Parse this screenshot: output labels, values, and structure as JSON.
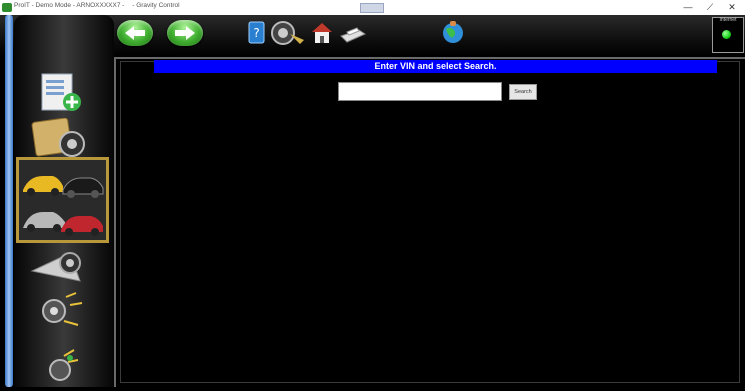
{
  "window": {
    "title": "ProIT - Demo Mode - ARNOXXXXX7 -",
    "title_extra": "- Gravity Control",
    "center_tab": "",
    "controls": {
      "minimize": "—",
      "restore": "⟋",
      "close": "✕"
    }
  },
  "toolbar": {
    "back_icon": "back-arrow-icon",
    "forward_icon": "forward-arrow-icon",
    "tools": [
      "help-book-icon",
      "wheel-icon",
      "home-icon",
      "printer-icon",
      "globe-person-icon"
    ],
    "internet_label": "Internet",
    "internet_status_color": "#19d219"
  },
  "sidebar": {
    "items": [
      {
        "icon": "car-icon"
      },
      {
        "icon": "add-document-icon"
      },
      {
        "icon": "clipboard-wheel-icon"
      },
      {
        "icon": "vehicle-selection-icon",
        "selected": true
      },
      {
        "icon": "wheel-alignment-icon"
      },
      {
        "icon": "wheel-adjust-icon"
      },
      {
        "icon": "wheel-settings-icon"
      }
    ]
  },
  "main": {
    "instruction": "Enter VIN and select Search.",
    "vin_value": "",
    "search_label": "Search"
  },
  "colors": {
    "instruction_bg": "#0000ff",
    "selected_border": "#b8983a",
    "nav_green": "#3fae2f"
  }
}
